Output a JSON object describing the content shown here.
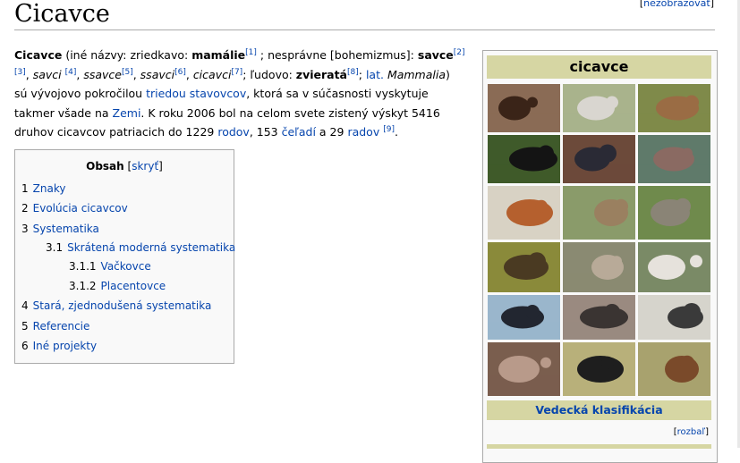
{
  "page": {
    "title": "Cicavce",
    "hide_link": "nezobrazovať"
  },
  "intro": {
    "term": "Cicavce",
    "p1": " (iné názvy: zriedkavo: ",
    "mamalie": "mamálie",
    "r1": "[1]",
    "p2": " ; nesprávne [bohemizmus]: ",
    "savce": "savce",
    "r2": "[2]",
    "r3": "[3]",
    "p3": ", ",
    "savci": "savci",
    "r4": "[4]",
    "p4": ", ",
    "ssavce": "ssavce",
    "r5": "[5]",
    "p5": ", ",
    "ssavci": "ssavci",
    "r6": "[6]",
    "p6": ", ",
    "cicavci": "cicavci",
    "r7": "[7]",
    "p7": "; ľudovo: ",
    "zvierata": "zvieratá",
    "r8": "[8]",
    "p8": "; ",
    "lat": "lat.",
    "p9": " ",
    "mammalia": "Mammalia",
    "p10": ") sú vývojovo pokročilou ",
    "trieda": "triedou",
    "p11": " ",
    "stavovcov": "stavovcov",
    "p12": ", ktorá sa v súčasnosti vyskytuje takmer všade na ",
    "zemi": "Zemi",
    "p13": ". K roku 2006 bol na celom svete zistený výskyt 5416 druhov cicavcov patriacich do 1229 ",
    "rodov": "rodov",
    "p14": ", 153 ",
    "celadi": "čeľadí",
    "p15": " a 29 ",
    "radov": "radov",
    "p16": " ",
    "r9": "[9]",
    "p17": "."
  },
  "toc": {
    "title": "Obsah",
    "toggle": "skryť",
    "items": [
      {
        "num": "1",
        "label": "Znaky"
      },
      {
        "num": "2",
        "label": "Evolúcia cicavcov"
      },
      {
        "num": "3",
        "label": "Systematika"
      },
      {
        "num": "3.1",
        "label": "Skrátená moderná systematika"
      },
      {
        "num": "3.1.1",
        "label": "Vačkovce"
      },
      {
        "num": "3.1.2",
        "label": "Placentovce"
      },
      {
        "num": "4",
        "label": "Stará, zjednodušená systematika"
      },
      {
        "num": "5",
        "label": "Referencie"
      },
      {
        "num": "6",
        "label": "Iné projekty"
      }
    ]
  },
  "infobox": {
    "title": "cicavce",
    "scientific_classification": "Vedecká klasifikácia",
    "expand": "rozbaľ",
    "photos": [
      {
        "name": "bat-photo",
        "bg": "#8a6b55",
        "fg": "#3a2418"
      },
      {
        "name": "opossum-photo",
        "bg": "#a9b38c",
        "fg": "#d9d6d0"
      },
      {
        "name": "kangaroo-photo",
        "bg": "#7f8a4a",
        "fg": "#9a6c44"
      },
      {
        "name": "tasmanian-devil-photo",
        "bg": "#3f5a2a",
        "fg": "#141414"
      },
      {
        "name": "humans-photo",
        "bg": "#6c4a3a",
        "fg": "#2a2a35"
      },
      {
        "name": "hippos-photo",
        "bg": "#5f7a6a",
        "fg": "#8a6a62"
      },
      {
        "name": "squirrel-photo",
        "bg": "#d8d2c4",
        "fg": "#b5602e"
      },
      {
        "name": "pangolin-photo",
        "bg": "#8a9b6a",
        "fg": "#9a8060"
      },
      {
        "name": "elephants-photo",
        "bg": "#6f8a4c",
        "fg": "#8a8476"
      },
      {
        "name": "platypus-photo",
        "bg": "#8a8a3a",
        "fg": "#4a3a22"
      },
      {
        "name": "armadillo-photo",
        "bg": "#8a8a72",
        "fg": "#b8aa98"
      },
      {
        "name": "reindeer-photo",
        "bg": "#7a8a66",
        "fg": "#e6e2dc"
      },
      {
        "name": "whale-photo",
        "bg": "#9ab6cc",
        "fg": "#222630"
      },
      {
        "name": "mole-photo",
        "bg": "#9a8a80",
        "fg": "#3a3432"
      },
      {
        "name": "anteater-photo",
        "bg": "#d6d4cc",
        "fg": "#3a3a3a"
      },
      {
        "name": "pig-photo",
        "bg": "#7a5e4e",
        "fg": "#b89a8a"
      },
      {
        "name": "zebras-photo",
        "bg": "#b8b07a",
        "fg": "#1e1e1e"
      },
      {
        "name": "elephant-shrew-photo",
        "bg": "#a8a26e",
        "fg": "#7a4a2a"
      }
    ]
  }
}
